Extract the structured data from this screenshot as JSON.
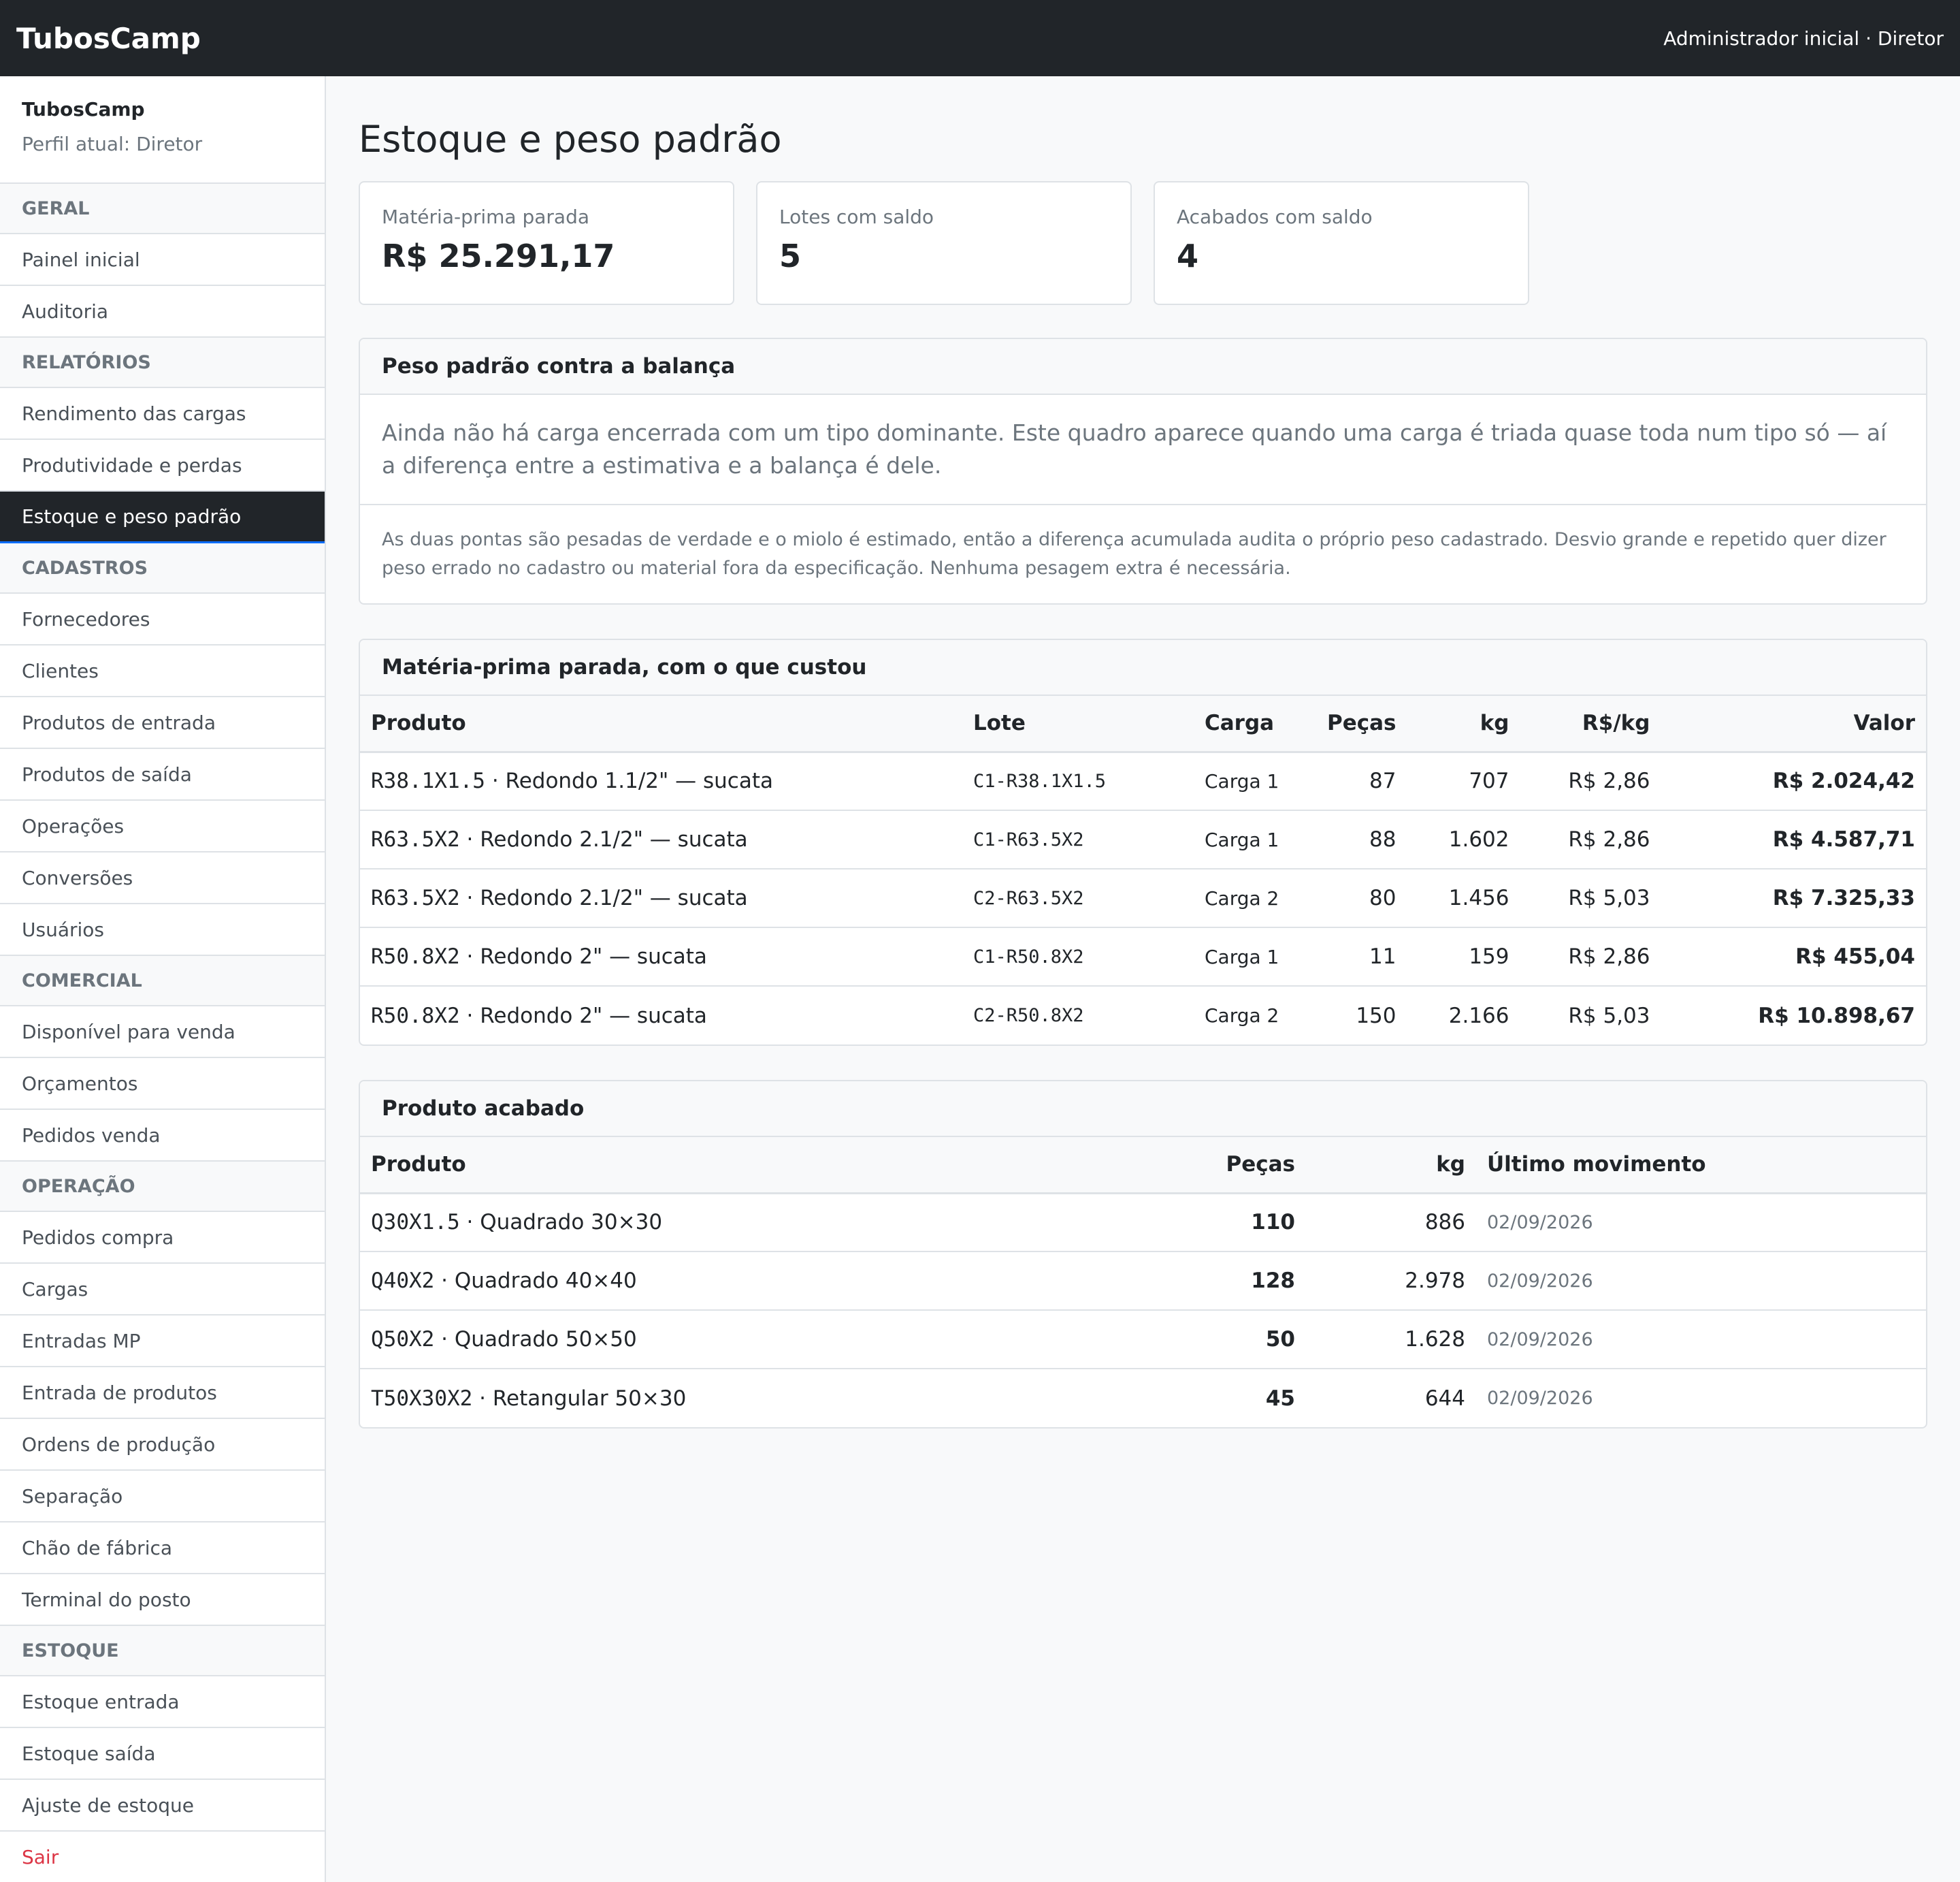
{
  "navbar": {
    "brand": "TubosCamp",
    "user": "Administrador inicial · Diretor"
  },
  "sidebar": {
    "app": "TubosCamp",
    "profile": "Perfil atual: Diretor",
    "groups": [
      {
        "title": "GERAL",
        "items": [
          "Painel inicial",
          "Auditoria"
        ]
      },
      {
        "title": "RELATÓRIOS",
        "items": [
          "Rendimento das cargas",
          "Produtividade e perdas",
          "Estoque e peso padrão"
        ]
      },
      {
        "title": "CADASTROS",
        "items": [
          "Fornecedores",
          "Clientes",
          "Produtos de entrada",
          "Produtos de saída",
          "Operações",
          "Conversões",
          "Usuários"
        ]
      },
      {
        "title": "COMERCIAL",
        "items": [
          "Disponível para venda",
          "Orçamentos",
          "Pedidos venda"
        ]
      },
      {
        "title": "OPERAÇÃO",
        "items": [
          "Pedidos compra",
          "Cargas",
          "Entradas MP",
          "Entrada de produtos",
          "Ordens de produção",
          "Separação",
          "Chão de fábrica",
          "Terminal do posto"
        ]
      },
      {
        "title": "ESTOQUE",
        "items": [
          "Estoque entrada",
          "Estoque saída",
          "Ajuste de estoque"
        ]
      }
    ],
    "logout": "Sair"
  },
  "page": {
    "title": "Estoque e peso padrão"
  },
  "stats": [
    {
      "label": "Matéria-prima parada",
      "value": "R$ 25.291,17"
    },
    {
      "label": "Lotes com saldo",
      "value": "5"
    },
    {
      "label": "Acabados com saldo",
      "value": "4"
    }
  ],
  "peso_card": {
    "title": "Peso padrão contra a balança",
    "lead": "Ainda não há carga encerrada com um tipo dominante. Este quadro aparece quando uma carga é triada quase toda num tipo só — aí a diferença entre a estimativa e a balança é dele.",
    "note": "As duas pontas são pesadas de verdade e o miolo é estimado, então a diferença acumulada audita o próprio peso cadastrado. Desvio grande e repetido quer dizer peso errado no cadastro ou material fora da especificação. Nenhuma pesagem extra é necessária."
  },
  "mp_card": {
    "title": "Matéria-prima parada, com o que custou",
    "headers": {
      "produto": "Produto",
      "lote": "Lote",
      "carga": "Carga",
      "pecas": "Peças",
      "kg": "kg",
      "rskg": "R$/kg",
      "valor": "Valor"
    },
    "rows": [
      {
        "code": "R38.1X1.5",
        "desc": " · Redondo 1.1/2\" — sucata",
        "lote": "C1-R38.1X1.5",
        "carga": "Carga 1",
        "pecas": "87",
        "kg": "707",
        "rskg": "R$ 2,86",
        "valor": "R$ 2.024,42"
      },
      {
        "code": "R63.5X2",
        "desc": " · Redondo 2.1/2\" — sucata",
        "lote": "C1-R63.5X2",
        "carga": "Carga 1",
        "pecas": "88",
        "kg": "1.602",
        "rskg": "R$ 2,86",
        "valor": "R$ 4.587,71"
      },
      {
        "code": "R63.5X2",
        "desc": " · Redondo 2.1/2\" — sucata",
        "lote": "C2-R63.5X2",
        "carga": "Carga 2",
        "pecas": "80",
        "kg": "1.456",
        "rskg": "R$ 5,03",
        "valor": "R$ 7.325,33"
      },
      {
        "code": "R50.8X2",
        "desc": " · Redondo 2\" — sucata",
        "lote": "C1-R50.8X2",
        "carga": "Carga 1",
        "pecas": "11",
        "kg": "159",
        "rskg": "R$ 2,86",
        "valor": "R$ 455,04"
      },
      {
        "code": "R50.8X2",
        "desc": " · Redondo 2\" — sucata",
        "lote": "C2-R50.8X2",
        "carga": "Carga 2",
        "pecas": "150",
        "kg": "2.166",
        "rskg": "R$ 5,03",
        "valor": "R$ 10.898,67"
      }
    ]
  },
  "pa_card": {
    "title": "Produto acabado",
    "headers": {
      "produto": "Produto",
      "pecas": "Peças",
      "kg": "kg",
      "ultimo": "Último movimento"
    },
    "rows": [
      {
        "code": "Q30X1.5",
        "desc": " · Quadrado 30×30",
        "pecas": "110",
        "kg": "886",
        "ultimo": "02/09/2026"
      },
      {
        "code": "Q40X2",
        "desc": " · Quadrado 40×40",
        "pecas": "128",
        "kg": "2.978",
        "ultimo": "02/09/2026"
      },
      {
        "code": "Q50X2",
        "desc": " · Quadrado 50×50",
        "pecas": "50",
        "kg": "1.628",
        "ultimo": "02/09/2026"
      },
      {
        "code": "T50X30X2",
        "desc": " · Retangular 50×30",
        "pecas": "45",
        "kg": "644",
        "ultimo": "02/09/2026"
      }
    ]
  }
}
